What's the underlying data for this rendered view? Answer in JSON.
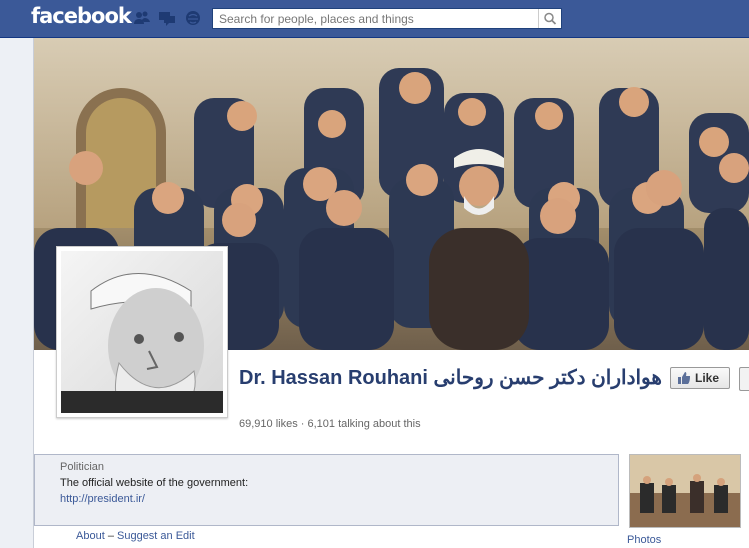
{
  "header": {
    "logo": "facebook",
    "search_placeholder": "Search for people, places and things"
  },
  "page": {
    "title_en": "Dr. Hassan Rouhani",
    "title_fa": "هواداران دکتر حسن روحانی",
    "stats": "69,910 likes · 6,101 talking about this",
    "like_label": "Like",
    "category": "Politician",
    "description": "The official website of the government:",
    "website": "http://president.ir/",
    "about_label": "About",
    "separator": "–",
    "suggest_label": "Suggest an Edit",
    "photos_label": "Photos"
  },
  "colors": {
    "brand": "#3b5998",
    "title": "#283e6f"
  },
  "icons": [
    "friend-requests-icon",
    "messages-icon",
    "notifications-icon",
    "search-icon",
    "like-thumb-icon"
  ]
}
